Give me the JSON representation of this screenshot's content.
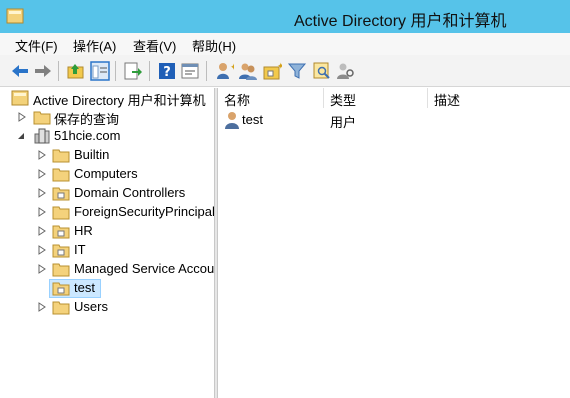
{
  "window": {
    "title": "Active Directory 用户和计算机"
  },
  "menu": [
    "文件(F)",
    "操作(A)",
    "查看(V)",
    "帮助(H)"
  ],
  "toolbar": [
    "back-icon",
    "forward-icon",
    "up-folder-icon",
    "show-tree-icon",
    "export-icon",
    "help-icon",
    "properties-icon",
    "new-user-icon",
    "new-group-icon",
    "new-ou-icon",
    "filter-icon",
    "find-icon",
    "delegate-icon"
  ],
  "tree": {
    "root": "Active Directory 用户和计算机",
    "saved_queries": "保存的查询",
    "domain": "51hcie.com",
    "children": [
      "Builtin",
      "Computers",
      "Domain Controllers",
      "ForeignSecurityPrincipals",
      "HR",
      "IT",
      "Managed Service Accounts",
      "test",
      "Users"
    ],
    "selected": "test"
  },
  "list": {
    "columns": [
      "名称",
      "类型",
      "描述"
    ],
    "rows": [
      {
        "name": "test",
        "type": "用户",
        "description": ""
      }
    ]
  }
}
